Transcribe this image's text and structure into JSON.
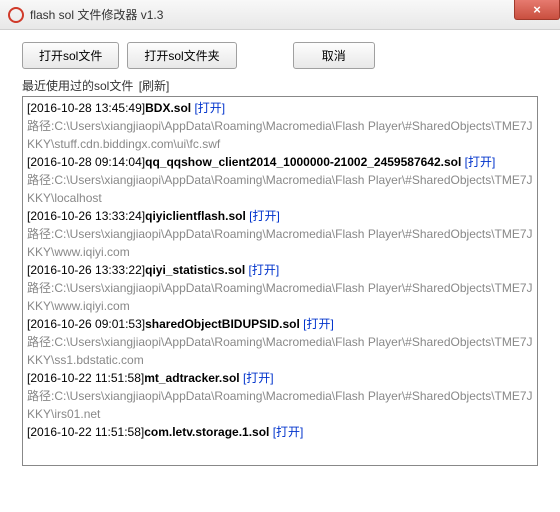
{
  "window": {
    "title": "flash sol 文件修改器 v1.3",
    "close_icon": "×"
  },
  "toolbar": {
    "open_file": "打开sol文件",
    "open_folder": "打开sol文件夹",
    "cancel": "取消"
  },
  "recent": {
    "label": "最近使用过的sol文件",
    "refresh": "[刷新]",
    "path_prefix": "路径:",
    "open_text": "[打开]",
    "items": [
      {
        "date": "[2016-10-28 13:45:49]",
        "name": "BDX.sol",
        "path": "C:\\Users\\xiangjiaopi\\AppData\\Roaming\\Macromedia\\Flash Player\\#SharedObjects\\TME7JKKY\\stuff.cdn.biddingx.com\\ui\\fc.swf"
      },
      {
        "date": "[2016-10-28 09:14:04]",
        "name": "qq_qqshow_client2014_1000000-21002_2459587642.sol",
        "path": "C:\\Users\\xiangjiaopi\\AppData\\Roaming\\Macromedia\\Flash Player\\#SharedObjects\\TME7JKKY\\localhost"
      },
      {
        "date": "[2016-10-26 13:33:24]",
        "name": "qiyiclientflash.sol",
        "path": "C:\\Users\\xiangjiaopi\\AppData\\Roaming\\Macromedia\\Flash Player\\#SharedObjects\\TME7JKKY\\www.iqiyi.com"
      },
      {
        "date": "[2016-10-26 13:33:22]",
        "name": "qiyi_statistics.sol",
        "path": "C:\\Users\\xiangjiaopi\\AppData\\Roaming\\Macromedia\\Flash Player\\#SharedObjects\\TME7JKKY\\www.iqiyi.com"
      },
      {
        "date": "[2016-10-26 09:01:53]",
        "name": "sharedObjectBIDUPSID.sol",
        "path": "C:\\Users\\xiangjiaopi\\AppData\\Roaming\\Macromedia\\Flash Player\\#SharedObjects\\TME7JKKY\\ss1.bdstatic.com"
      },
      {
        "date": "[2016-10-22 11:51:58]",
        "name": "mt_adtracker.sol",
        "path": "C:\\Users\\xiangjiaopi\\AppData\\Roaming\\Macromedia\\Flash Player\\#SharedObjects\\TME7JKKY\\irs01.net"
      },
      {
        "date": "[2016-10-22 11:51:58]",
        "name": "com.letv.storage.1.sol",
        "path": ""
      }
    ]
  }
}
